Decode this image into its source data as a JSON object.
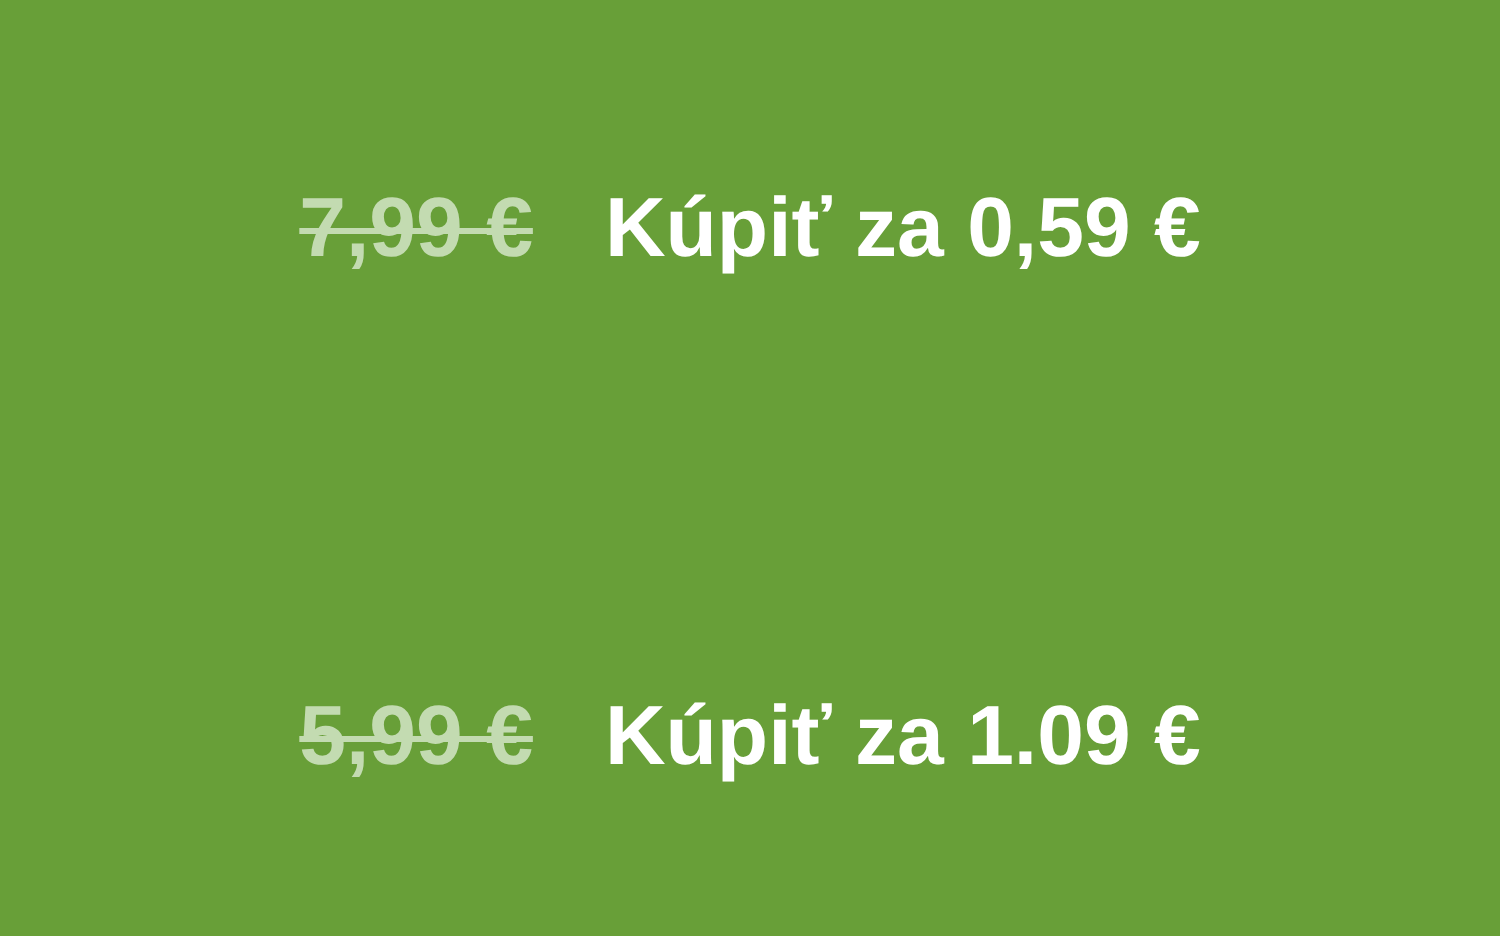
{
  "offers": [
    {
      "old_price": "7,99 €",
      "buy_label": "Kúpiť za 0,59 €"
    },
    {
      "old_price": "5,99 €",
      "buy_label": "Kúpiť za 1.09 €"
    }
  ]
}
